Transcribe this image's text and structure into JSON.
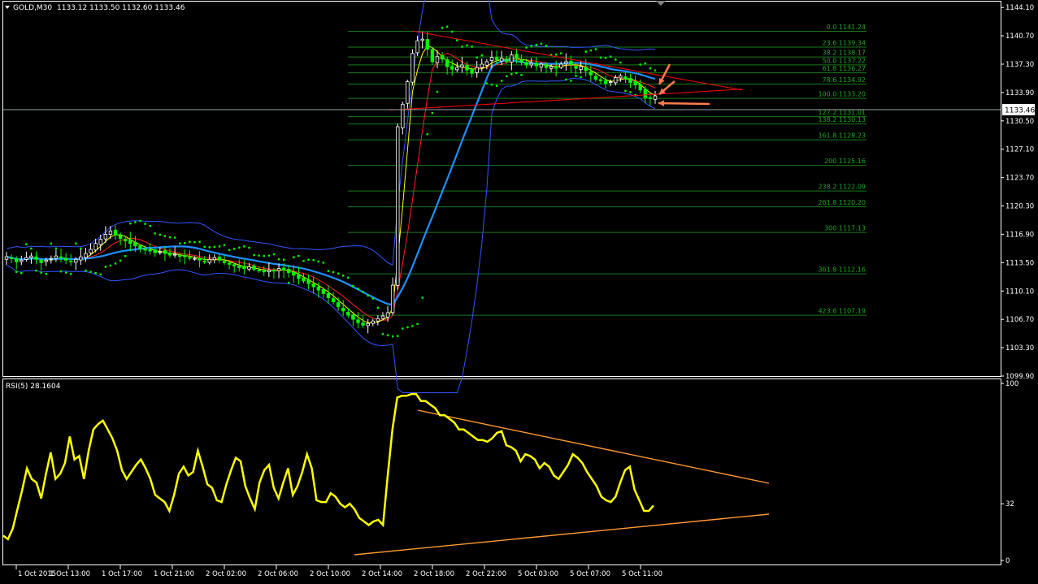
{
  "header": {
    "symbol_label": "GOLD,M30",
    "ohlc": "1133.12 1133.50 1132.60 1133.46"
  },
  "rsi_header": "RSI(5) 28.1604",
  "current_price": "1133.46",
  "colors": {
    "background": "#000000",
    "bull_candle": "#ffffff",
    "bear_candle": "#00ff00",
    "bollinger": "#3355ff",
    "ma_blue": "#1e90ff",
    "ma_red": "#ff2020",
    "ma_yellow": "#ffff00",
    "sar": "#00ff00",
    "fib": "#1a7a1a",
    "fib_label": "#1fa81f",
    "rsi_line": "#ffff00",
    "trendline_rsi": "#ff9933",
    "trendline_price": "#ff0000",
    "arrow": "#ff7a4d",
    "grid_text": "#ffffff"
  },
  "chart_data": [
    {
      "type": "candlestick",
      "title": "GOLD,M30",
      "y_ticks": [
        "1144.10",
        "1140.70",
        "1137.30",
        "1133.90",
        "1130.50",
        "1127.10",
        "1123.70",
        "1120.30",
        "1116.90",
        "1113.50",
        "1110.10",
        "1106.70",
        "1103.30",
        "1099.90"
      ],
      "ylim": [
        1099.9,
        1144.8
      ],
      "x_ticks": [
        "1 Oct 2015",
        "1 Oct 13:00",
        "1 Oct 17:00",
        "1 Oct 21:00",
        "2 Oct 02:00",
        "2 Oct 06:00",
        "2 Oct 10:00",
        "2 Oct 14:00",
        "2 Oct 18:00",
        "2 Oct 22:00",
        "5 Oct 03:00",
        "5 Oct 07:00",
        "5 Oct 11:00"
      ],
      "fibonacci": [
        {
          "level": "0.0",
          "price": "1141.24"
        },
        {
          "level": "23.6",
          "price": "1139.34"
        },
        {
          "level": "38.2",
          "price": "1138.17"
        },
        {
          "level": "50.0",
          "price": "1137.22"
        },
        {
          "level": "61.8",
          "price": "1136.27"
        },
        {
          "level": "78.6",
          "price": "1134.92"
        },
        {
          "level": "100.0",
          "price": "1133.20"
        },
        {
          "level": "127.2",
          "price": "1131.01"
        },
        {
          "level": "138.2",
          "price": "1130.13"
        },
        {
          "level": "161.8",
          "price": "1128.23"
        },
        {
          "level": "200",
          "price": "1125.16"
        },
        {
          "level": "238.2",
          "price": "1122.09"
        },
        {
          "level": "261.8",
          "price": "1120.20"
        },
        {
          "level": "300",
          "price": "1117.13"
        },
        {
          "level": "361.8",
          "price": "1112.16"
        },
        {
          "level": "423.6",
          "price": "1107.19"
        }
      ],
      "current_price": 1133.46,
      "close": [
        1114.2,
        1114.0,
        1113.6,
        1113.8,
        1114.1,
        1114.3,
        1113.9,
        1113.5,
        1113.8,
        1114.0,
        1114.3,
        1114.1,
        1113.8,
        1113.6,
        1113.9,
        1114.2,
        1114.6,
        1115.1,
        1115.8,
        1116.3,
        1116.9,
        1117.3,
        1116.8,
        1116.4,
        1116.1,
        1115.8,
        1115.5,
        1115.2,
        1115.0,
        1114.9,
        1114.7,
        1114.8,
        1114.6,
        1114.4,
        1114.5,
        1114.3,
        1114.2,
        1114.1,
        1114.0,
        1113.8,
        1113.6,
        1113.9,
        1114.1,
        1113.8,
        1113.5,
        1113.3,
        1113.1,
        1112.9,
        1112.8,
        1113.0,
        1112.7,
        1112.5,
        1112.4,
        1112.6,
        1112.5,
        1112.8,
        1112.6,
        1112.3,
        1112.0,
        1111.6,
        1111.3,
        1111.0,
        1110.6,
        1110.2,
        1109.8,
        1109.3,
        1108.8,
        1108.2,
        1107.7,
        1107.2,
        1106.7,
        1106.3,
        1106.0,
        1106.2,
        1106.5,
        1106.8,
        1107.1,
        1107.5,
        1110.8,
        1129.8,
        1132.5,
        1135.2,
        1138.6,
        1140.1,
        1140.3,
        1139.1,
        1137.6,
        1138.2,
        1137.9,
        1137.0,
        1136.7,
        1136.9,
        1137.2,
        1136.6,
        1136.2,
        1136.9,
        1137.3,
        1137.6,
        1138.1,
        1137.8,
        1138.0,
        1137.6,
        1138.4,
        1138.0,
        1137.5,
        1137.2,
        1137.4,
        1137.1,
        1137.3,
        1136.9,
        1137.0,
        1136.8,
        1137.3,
        1137.6,
        1137.2,
        1136.8,
        1137.0,
        1136.5,
        1136.0,
        1135.5,
        1135.3,
        1135.0,
        1135.2,
        1135.7,
        1135.9,
        1135.5,
        1135.1,
        1134.8,
        1134.2,
        1133.3,
        1133.2,
        1133.5
      ],
      "series": [
        {
          "name": "Bollinger upper"
        },
        {
          "name": "Bollinger lower"
        },
        {
          "name": "MA blue"
        },
        {
          "name": "MA red"
        },
        {
          "name": "MA yellow"
        },
        {
          "name": "Parabolic SAR"
        }
      ]
    },
    {
      "type": "line",
      "title": "RSI(5) 28.1604",
      "ylim": [
        0,
        100
      ],
      "y_ticks": [
        "100",
        "32",
        "0"
      ],
      "values": [
        14,
        12,
        18,
        29,
        40,
        52,
        46,
        44,
        35,
        49,
        61,
        46,
        49,
        55,
        70,
        57,
        59,
        46,
        62,
        74,
        77,
        79,
        74,
        69,
        62,
        51,
        46,
        50,
        54,
        57,
        52,
        46,
        37,
        35,
        33,
        28,
        37,
        49,
        53,
        48,
        50,
        62,
        53,
        43,
        41,
        34,
        33,
        43,
        51,
        58,
        56,
        42,
        35,
        29,
        44,
        51,
        54,
        41,
        35,
        44,
        52,
        37,
        42,
        50,
        60,
        52,
        34,
        33,
        33,
        38,
        36,
        32,
        30,
        32,
        29,
        24,
        22,
        20,
        22,
        23,
        20,
        48,
        74,
        92,
        93,
        93,
        94,
        94,
        90,
        90,
        88,
        86,
        82,
        82,
        80,
        78,
        74,
        74,
        72,
        70,
        68,
        68,
        67,
        69,
        72,
        73,
        65,
        64,
        62,
        56,
        60,
        59,
        57,
        52,
        55,
        53,
        48,
        46,
        50,
        54,
        60,
        58,
        55,
        50,
        46,
        42,
        36,
        34,
        33,
        36,
        44,
        51,
        53,
        40,
        34,
        28,
        28,
        31
      ]
    }
  ]
}
